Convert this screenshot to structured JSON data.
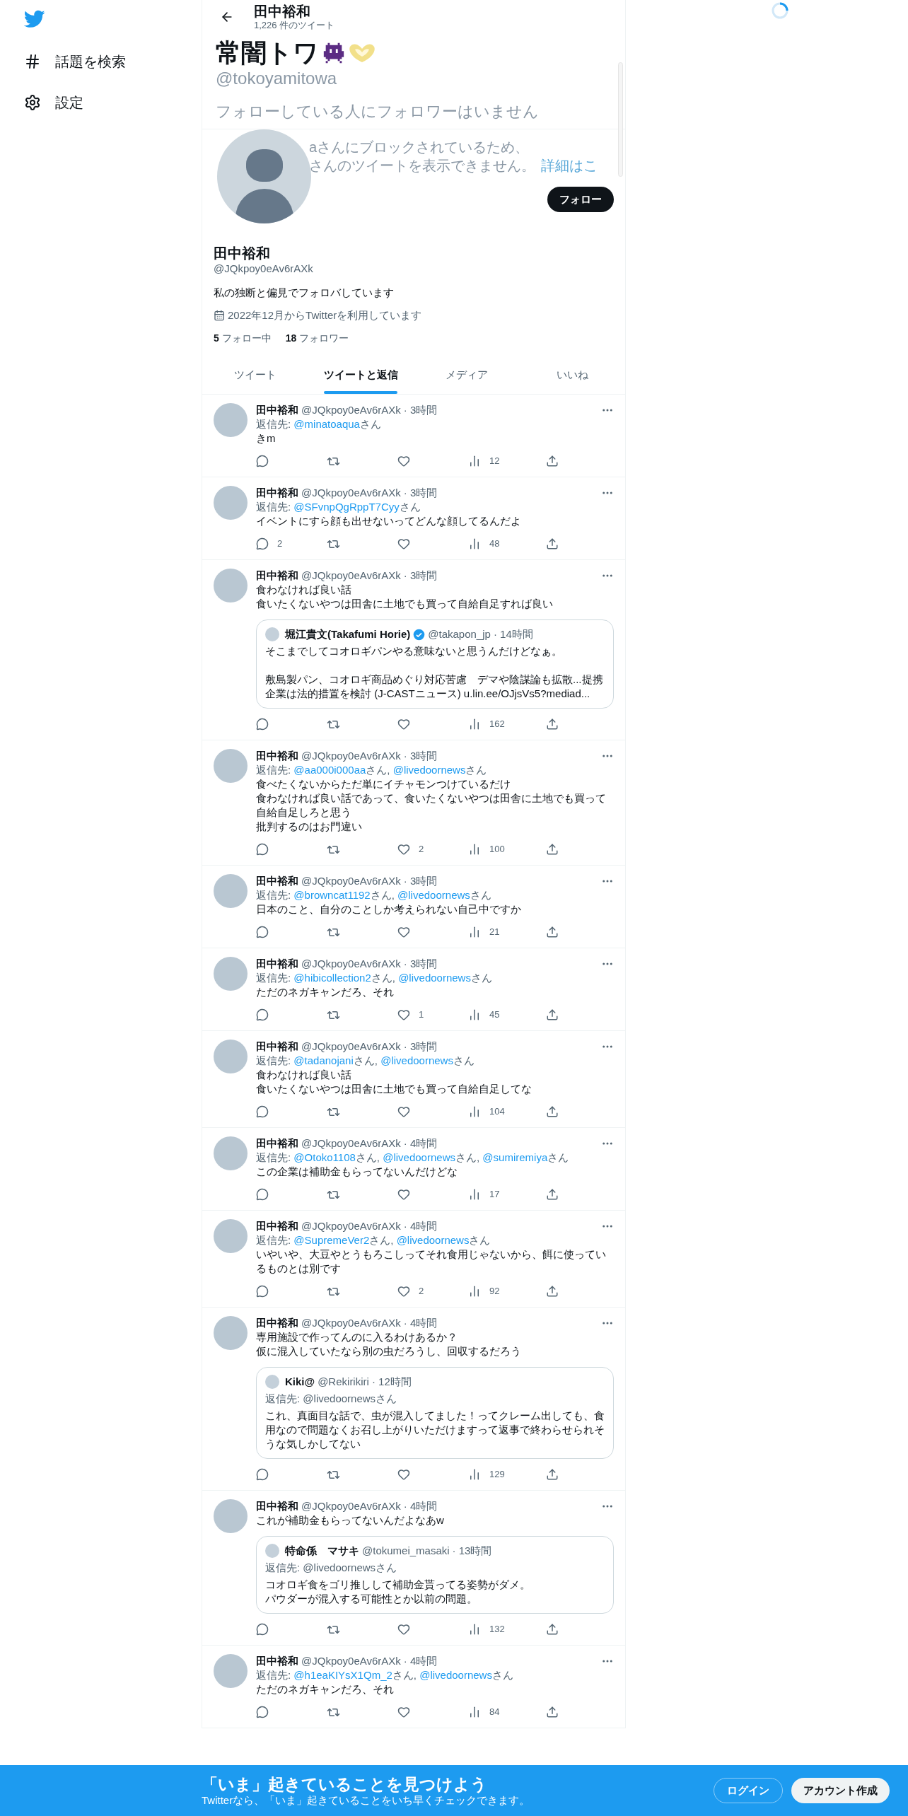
{
  "sidebar": {
    "items": [
      {
        "kind": "hash",
        "label": "話題を検索"
      },
      {
        "kind": "gear",
        "label": "設定"
      }
    ]
  },
  "header": {
    "name": "田中裕和",
    "tweet_count": "1,226 件のツイート"
  },
  "hover_card": {
    "name": "常闇トワ",
    "handle": "@tokoyamitowa",
    "followers_note": "フォローしている人にフォロワーはいません",
    "blocked_line_1": "aさんにブロックされているため、",
    "blocked_line_2": "さんのツイートを表示できません。",
    "details_link": "詳細はこ"
  },
  "profile": {
    "follow_button": "フォロー",
    "name": "田中裕和",
    "handle": "@JQkpoy0eAv6rAXk",
    "bio": "私の独断と偏見でフォロバしています",
    "joined": "2022年12月からTwitterを利用しています",
    "following_count": "5",
    "following_label": "フォロー中",
    "followers_count": "18",
    "followers_label": "フォロワー"
  },
  "tabs": [
    {
      "label": "ツイート",
      "selected": false
    },
    {
      "label": "ツイートと返信",
      "selected": true
    },
    {
      "label": "メディア",
      "selected": false
    },
    {
      "label": "いいね",
      "selected": false
    }
  ],
  "tweets": [
    {
      "author": "田中裕和",
      "handle": "@JQkpoy0eAv6rAXk",
      "time": "· 3時間",
      "reply_label": "返信先:",
      "reply_to": [
        {
          "handle": "@minatoaqua",
          "suffix": "さん"
        }
      ],
      "text": "きm",
      "views": "12"
    },
    {
      "author": "田中裕和",
      "handle": "@JQkpoy0eAv6rAXk",
      "time": "· 3時間",
      "reply_label": "返信先:",
      "reply_to": [
        {
          "handle": "@SFvnpQgRppT7Cyy",
          "suffix": "さん"
        }
      ],
      "text": "イベントにすら顔も出せないってどんな顔してるんだよ",
      "replies": "2",
      "views": "48"
    },
    {
      "author": "田中裕和",
      "handle": "@JQkpoy0eAv6rAXk",
      "time": "· 3時間",
      "lines": [
        "食わなければ良い話",
        "食いたくないやつは田舎に土地でも買って自給自足すれば良い"
      ],
      "quote": {
        "author": "堀江貴文(Takafumi Horie)",
        "verified": true,
        "handle": "@takapon_jp",
        "time": "· 14時間",
        "paragraphs": [
          [
            "そこまでしてコオロギパンやる意味ないと思うんだけどなぁ。"
          ],
          [
            "敷島製パン、コオロギ商品めぐり対応苦慮　デマや陰謀論も拡散...提携",
            "企業は法的措置を検討 (J-CASTニュース) u.lin.ee/OJjsVs5?mediad..."
          ]
        ]
      },
      "views": "162"
    },
    {
      "author": "田中裕和",
      "handle": "@JQkpoy0eAv6rAXk",
      "time": "· 3時間",
      "reply_label": "返信先:",
      "reply_to": [
        {
          "handle": "@aa000i000aa",
          "suffix": "さん, "
        },
        {
          "handle": "@livedoornews",
          "suffix": "さん"
        }
      ],
      "lines": [
        "食べたくないからただ単にイチャモンつけているだけ",
        "食わなければ良い話であって、食いたくないやつは田舎に土地でも買って",
        "自給自足しろと思う",
        "批判するのはお門違い"
      ],
      "likes": "2",
      "views": "100"
    },
    {
      "author": "田中裕和",
      "handle": "@JQkpoy0eAv6rAXk",
      "time": "· 3時間",
      "reply_label": "返信先:",
      "reply_to": [
        {
          "handle": "@browncat1192",
          "suffix": "さん, "
        },
        {
          "handle": "@livedoornews",
          "suffix": "さん"
        }
      ],
      "text": "日本のこと、自分のことしか考えられない自己中ですか",
      "views": "21"
    },
    {
      "author": "田中裕和",
      "handle": "@JQkpoy0eAv6rAXk",
      "time": "· 3時間",
      "reply_label": "返信先:",
      "reply_to": [
        {
          "handle": "@hibicollection2",
          "suffix": "さん, "
        },
        {
          "handle": "@livedoornews",
          "suffix": "さん"
        }
      ],
      "text": "ただのネガキャンだろ、それ",
      "likes": "1",
      "views": "45"
    },
    {
      "author": "田中裕和",
      "handle": "@JQkpoy0eAv6rAXk",
      "time": "· 3時間",
      "reply_label": "返信先:",
      "reply_to": [
        {
          "handle": "@tadanojani",
          "suffix": "さん, "
        },
        {
          "handle": "@livedoornews",
          "suffix": "さん"
        }
      ],
      "lines": [
        "食わなければ良い話",
        "食いたくないやつは田舎に土地でも買って自給自足してな"
      ],
      "views": "104"
    },
    {
      "author": "田中裕和",
      "handle": "@JQkpoy0eAv6rAXk",
      "time": "· 4時間",
      "reply_label": "返信先:",
      "reply_to": [
        {
          "handle": "@Otoko1108",
          "suffix": "さん, "
        },
        {
          "handle": "@livedoornews",
          "suffix": "さん, "
        },
        {
          "handle": "@sumiremiya",
          "suffix": "さん"
        }
      ],
      "text": "この企業は補助金もらってないんだけどな",
      "views": "17"
    },
    {
      "author": "田中裕和",
      "handle": "@JQkpoy0eAv6rAXk",
      "time": "· 4時間",
      "reply_label": "返信先:",
      "reply_to": [
        {
          "handle": "@SupremeVer2",
          "suffix": "さん, "
        },
        {
          "handle": "@livedoornews",
          "suffix": "さん"
        }
      ],
      "text": "いやいや、大豆やとうもろこしってそれ食用じゃないから、餌に使っているものとは別です",
      "likes": "2",
      "views": "92"
    },
    {
      "author": "田中裕和",
      "handle": "@JQkpoy0eAv6rAXk",
      "time": "· 4時間",
      "lines": [
        "専用施設で作ってんのに入るわけあるか？",
        "仮に混入していたなら別の虫だろうし、回収するだろう"
      ],
      "quote": {
        "author": "Kiki@",
        "verified": false,
        "handle": "@Rekirikiri",
        "time": "· 12時間",
        "reply_line": "返信先: @livedoornewsさん",
        "paragraphs": [
          [
            "これ、真面目な話で、虫が混入してました！ってクレーム出しても、食用なので問題なくお召し上がりいただけますって返事で終わらせられそうな気しかしてない"
          ]
        ]
      },
      "views": "129"
    },
    {
      "author": "田中裕和",
      "handle": "@JQkpoy0eAv6rAXk",
      "time": "· 4時間",
      "text": "これが補助金もらってないんだよなあw",
      "quote": {
        "author": "特命係　マサキ",
        "verified": false,
        "handle": "@tokumei_masaki",
        "time": "· 13時間",
        "reply_line": "返信先: @livedoornewsさん",
        "paragraphs": [
          [
            "コオロギ食をゴリ推しして補助金貰ってる姿勢がダメ。",
            "パウダーが混入する可能性とか以前の問題。"
          ]
        ]
      },
      "views": "132"
    },
    {
      "author": "田中裕和",
      "handle": "@JQkpoy0eAv6rAXk",
      "time": "· 4時間",
      "reply_label": "返信先:",
      "reply_to": [
        {
          "handle": "@h1eaKIYsX1Qm_2",
          "suffix": "さん, "
        },
        {
          "handle": "@livedoornews",
          "suffix": "さん"
        }
      ],
      "text": "ただのネガキャンだろ、それ",
      "views": "84"
    }
  ],
  "banner": {
    "title": "「いま」起きていることを見つけよう",
    "subtitle": "Twitterなら、「いま」起きていることをいち早くチェックできます。",
    "login": "ログイン",
    "signup": "アカウント作成"
  }
}
